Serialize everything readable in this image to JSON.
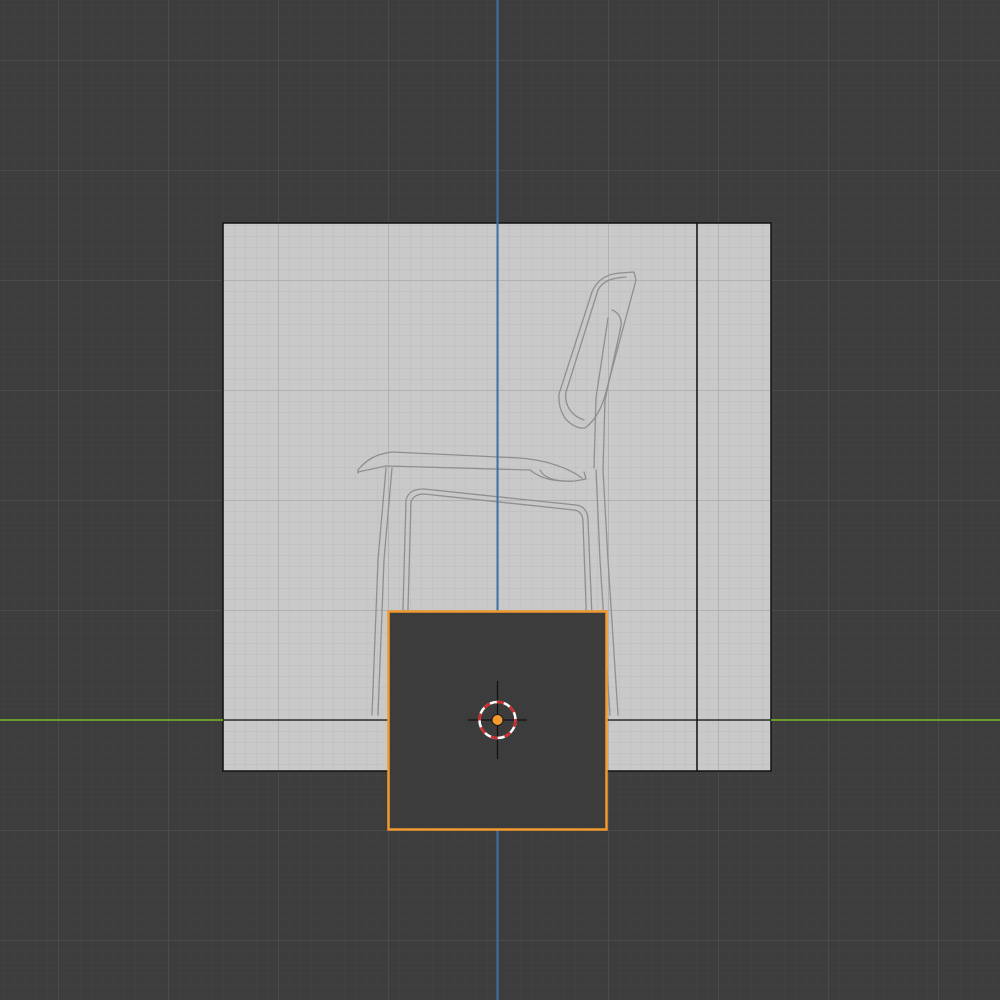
{
  "viewport": {
    "view": "front-orthographic",
    "background_color": "#3d3d3d",
    "grid_minor_color": "#444444",
    "grid_major_color": "#4f4f4f",
    "x_axis_color": "#6a9a2a",
    "z_axis_color": "#3f6fa8"
  },
  "reference_image": {
    "object": "chair-side-view",
    "background_color": "#c9c9c9",
    "grid_minor_color": "#bdbdbd",
    "grid_major_color": "#a9a9a9",
    "outline_color": "#111111",
    "sketch_color": "#8f8f8f"
  },
  "selected_object": {
    "type": "plane",
    "fill_color": "#3c3c3c",
    "outline_color": "#f29a2e",
    "origin_color": "#f29a2e"
  },
  "cursor_3d": {
    "ring_color_a": "#d42a2a",
    "ring_color_b": "#ffffff",
    "crosshair_color": "#111111"
  }
}
